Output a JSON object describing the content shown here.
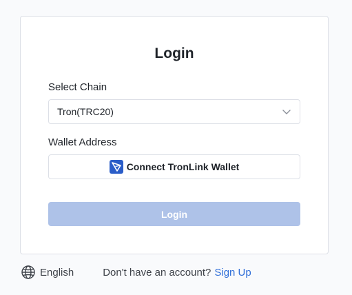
{
  "login_card": {
    "title": "Login",
    "chain_label": "Select Chain",
    "chain_value": "Tron(TRC20)",
    "wallet_label": "Wallet Address",
    "connect_button_label": "Connect TronLink Wallet",
    "submit_label": "Login"
  },
  "footer": {
    "language": "English",
    "prompt": "Don't have an account?",
    "signup_link": "Sign Up"
  },
  "icons": {
    "chain_dropdown": "chevron-down-icon",
    "wallet": "tronlink-icon",
    "language": "globe-icon"
  },
  "colors": {
    "accent": "#2f6ed8",
    "login_button_disabled": "#aec2e8",
    "tronlink_brand": "#2a5dc8"
  }
}
